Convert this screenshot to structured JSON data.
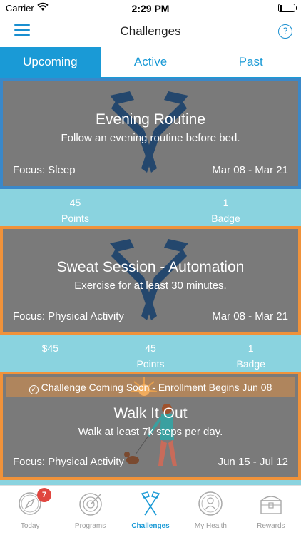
{
  "status": {
    "carrier": "Carrier",
    "time": "2:29 PM"
  },
  "nav": {
    "title": "Challenges",
    "help": "?"
  },
  "tabs": [
    {
      "label": "Upcoming",
      "active": true
    },
    {
      "label": "Active",
      "active": false
    },
    {
      "label": "Past",
      "active": false
    }
  ],
  "challenges": [
    {
      "title": "Evening Routine",
      "description": "Follow an evening routine before bed.",
      "focus": "Focus: Sleep",
      "dates": "Mar 08 - Mar 21",
      "rewards": [
        {
          "value": "45",
          "label": "Points"
        },
        {
          "value": "1",
          "label": "Badge"
        }
      ]
    },
    {
      "title": "Sweat Session - Automation",
      "description": "Exercise for at least 30 minutes.",
      "focus": "Focus: Physical Activity",
      "dates": "Mar 08 - Mar 21",
      "rewards": [
        {
          "value": "$45",
          "label": ""
        },
        {
          "value": "45",
          "label": "Points"
        },
        {
          "value": "1",
          "label": "Badge"
        }
      ]
    },
    {
      "banner": "Challenge Coming Soon - Enrollment Begins Jun 08",
      "title": "Walk It Out",
      "description": "Walk at least 7k steps per day.",
      "focus": "Focus: Physical Activity",
      "dates": "Jun 15 - Jul 12"
    }
  ],
  "tabbar": [
    {
      "label": "Today",
      "icon": "compass-icon",
      "badge": "7"
    },
    {
      "label": "Programs",
      "icon": "target-icon"
    },
    {
      "label": "Challenges",
      "icon": "flags-icon",
      "active": true
    },
    {
      "label": "My Health",
      "icon": "person-icon"
    },
    {
      "label": "Rewards",
      "icon": "treasure-chest-icon"
    }
  ],
  "colors": {
    "accent": "#1a9ad6",
    "reward_strip": "#8ad3df",
    "card_gray": "#818181",
    "border_blue": "#3a88c9",
    "border_orange": "#f0923a",
    "flag_navy": "#163f6b",
    "badge_red": "#e0463f"
  }
}
